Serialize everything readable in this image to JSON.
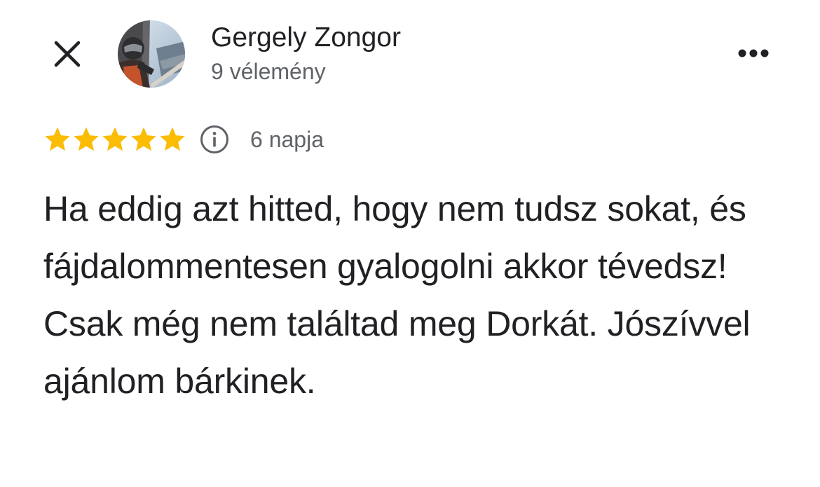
{
  "header": {
    "close_icon": "close-icon",
    "more_icon": "more-horizontal-icon",
    "author_name": "Gergely Zongor",
    "review_count": "9 vélemény",
    "avatar": "profile-photo"
  },
  "review": {
    "rating": 5,
    "rating_max": 5,
    "star_color": "#fbbc04",
    "info_icon": "info-icon",
    "date": "6 napja",
    "text": "Ha eddig azt hitted, hogy nem tudsz sokat, és fájdalommentesen gyalogolni akkor tévedsz! Csak még nem találtad meg Dorkát. Jószívvel ajánlom bárkinek."
  }
}
